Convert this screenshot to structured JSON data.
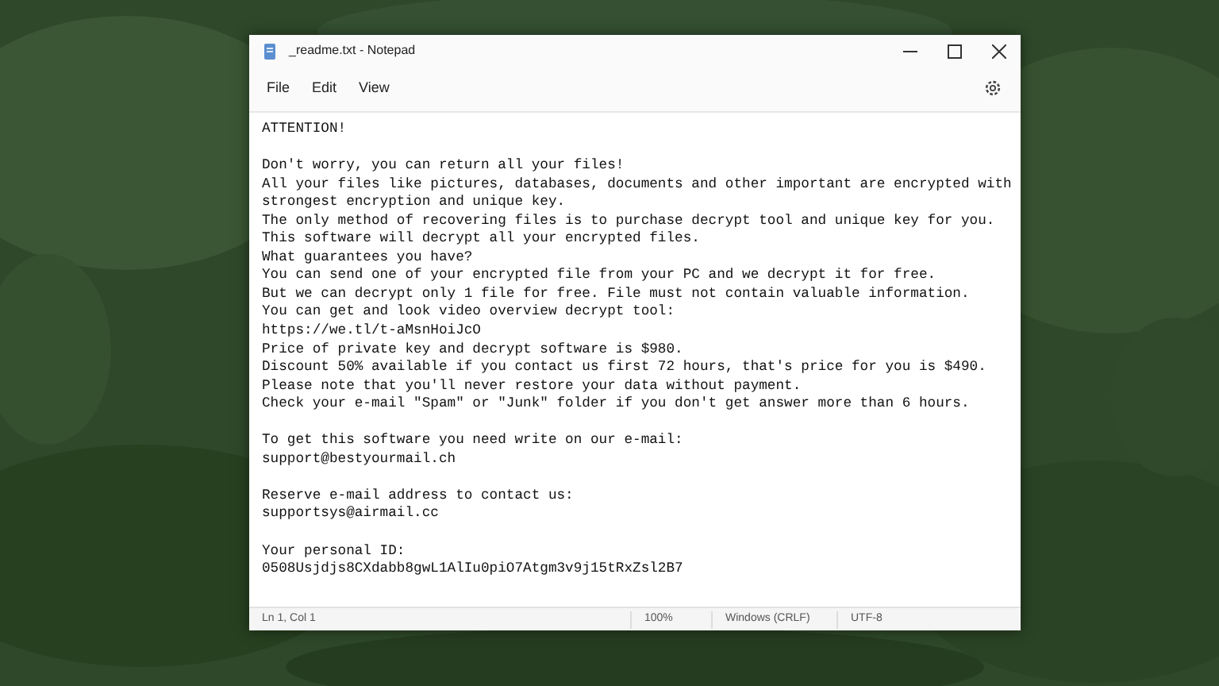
{
  "window": {
    "title": "_readme.txt - Notepad"
  },
  "menu": [
    {
      "label": "File"
    },
    {
      "label": "Edit"
    },
    {
      "label": "View"
    }
  ],
  "paragraphs": [
    {
      "kind": "normal",
      "lines": [
        "ATTENTION!"
      ]
    },
    {
      "kind": "normal",
      "lines": [
        "Don't worry, you can return all your files!",
        "All your files like pictures, databases, documents and other important are encrypted with",
        "strongest encryption and unique key.",
        "The only method of recovering files is to purchase decrypt tool and unique key for you.",
        "This software will decrypt all your encrypted files.",
        "What guarantees you have?",
        "You can send one of your encrypted file from your PC and we decrypt it for free.",
        "But we can decrypt only 1 file for free. File must not contain valuable information.",
        "You can get and look video overview decrypt tool:",
        "https://we.tl/t-aMsnHoiJcO",
        "Price of private key and decrypt software is $980.",
        "Discount 50% available if you contact us first 72 hours, that's price for you is $490.",
        "Please note that you'll never restore your data without payment.",
        "Check your e-mail \"Spam\" or \"Junk\" folder if you don't get answer more than 6 hours."
      ]
    },
    {
      "kind": "wide",
      "lines": [
        "To get this software you need write on our e-mail:",
        "support@bestyourmail.ch"
      ]
    },
    {
      "kind": "normal",
      "lines": [
        "Reserve e-mail address to contact us:",
        "supportsys@airmail.cc"
      ]
    },
    {
      "kind": "normal",
      "lines": [
        "Your personal ID:",
        "0508Usjdjs8CXdabb8gwL1AlIu0piO7Atgm3v9j15tRxZsl2B7"
      ]
    }
  ],
  "status_bar": {
    "position": "Ln 1, Col 1",
    "zoom": "100%",
    "line_ending": "Windows (CRLF)",
    "encoding": "UTF-8"
  }
}
